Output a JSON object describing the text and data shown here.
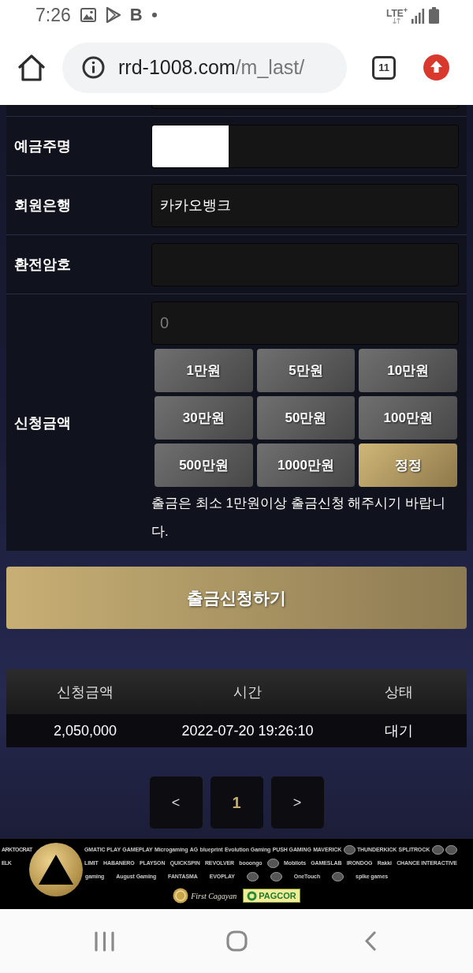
{
  "status_bar": {
    "time": "7:26",
    "app_letter": "B",
    "network": "LTE$^{+}$"
  },
  "browser": {
    "url_host": "rrd-1008.com",
    "url_path": "/m_last/",
    "tab_count": "11"
  },
  "form": {
    "fields": [
      {
        "label": "예금주명",
        "kind": "redacted"
      },
      {
        "label": "회원은행",
        "kind": "text",
        "value": "카카오뱅크"
      },
      {
        "label": "환전암호",
        "kind": "text"
      }
    ],
    "amount": {
      "label": "신청금액",
      "placeholder": "0",
      "quick_buttons": [
        {
          "label": "1만원",
          "kind": "add"
        },
        {
          "label": "5만원",
          "kind": "add"
        },
        {
          "label": "10만원",
          "kind": "add"
        },
        {
          "label": "30만원",
          "kind": "add"
        },
        {
          "label": "50만원",
          "kind": "add"
        },
        {
          "label": "100만원",
          "kind": "add"
        },
        {
          "label": "500만원",
          "kind": "add"
        },
        {
          "label": "1000만원",
          "kind": "add"
        },
        {
          "label": "정정",
          "kind": "reset"
        }
      ],
      "note": "출금은 최소 1만원이상 출금신청 해주시기 바랍니다."
    }
  },
  "submit_button": "출금신청하기",
  "history": {
    "columns": [
      "신청금액",
      "시간",
      "상태"
    ],
    "rows": [
      [
        "2,050,000",
        "2022-07-20 19:26:10",
        "대기"
      ]
    ]
  },
  "pagination": [
    {
      "label": "<",
      "selected": false
    },
    {
      "label": "1",
      "selected": true
    },
    {
      "label": ">",
      "selected": false
    }
  ],
  "footer": {
    "logo_rows": [
      [
        {
          "kind": "text",
          "text": "ARKTOCRAT"
        },
        {
          "kind": "text",
          "text": "GMATIC PLAY"
        },
        {
          "kind": "text",
          "text": "GAMEPLAY"
        },
        {
          "kind": "text",
          "text": "Microgaming"
        },
        {
          "kind": "text",
          "text": "AG"
        },
        {
          "kind": "text",
          "text": "blueprint"
        },
        {
          "kind": "text",
          "text": "Evolution Gaming"
        },
        {
          "kind": "text",
          "text": "PUSH GAMING"
        },
        {
          "kind": "text",
          "text": "MAVERICK"
        },
        {
          "kind": "emblem"
        },
        {
          "kind": "text",
          "text": "THUNDERKICK"
        },
        {
          "kind": "text",
          "text": "SPLITROCK"
        },
        {
          "kind": "emblem"
        },
        {
          "kind": "emblem"
        }
      ],
      [
        {
          "kind": "text",
          "text": "ELK"
        },
        {
          "kind": "text",
          "text": "LIMIT"
        },
        {
          "kind": "text",
          "text": "HABANERO"
        },
        {
          "kind": "text",
          "text": "PLAYSON"
        },
        {
          "kind": "text",
          "text": "QUICKSPIN"
        },
        {
          "kind": "text",
          "text": "REVOLVER"
        },
        {
          "kind": "text",
          "text": "booongo"
        },
        {
          "kind": "emblem"
        },
        {
          "kind": "text",
          "text": "Mobilots"
        },
        {
          "kind": "text",
          "text": "GAMESLAB"
        },
        {
          "kind": "text",
          "text": "IRONDOG"
        },
        {
          "kind": "text",
          "text": "Rakki"
        },
        {
          "kind": "text",
          "text": "CHANCE INTERACTIVE"
        }
      ],
      [
        {
          "kind": "text",
          "text": "gaming"
        },
        {
          "kind": "text",
          "text": "August Gaming"
        },
        {
          "kind": "text",
          "text": "FANTASMA"
        },
        {
          "kind": "text",
          "text": "EVOPLAY"
        },
        {
          "kind": "emblem"
        },
        {
          "kind": "emblem"
        },
        {
          "kind": "text",
          "text": "OneTouch"
        },
        {
          "kind": "emblem"
        },
        {
          "kind": "text",
          "text": "spike games"
        }
      ]
    ],
    "badges": [
      {
        "kind": "seal",
        "text": "First Cagayan"
      },
      {
        "kind": "plate",
        "text": "PAGCOR"
      }
    ]
  }
}
